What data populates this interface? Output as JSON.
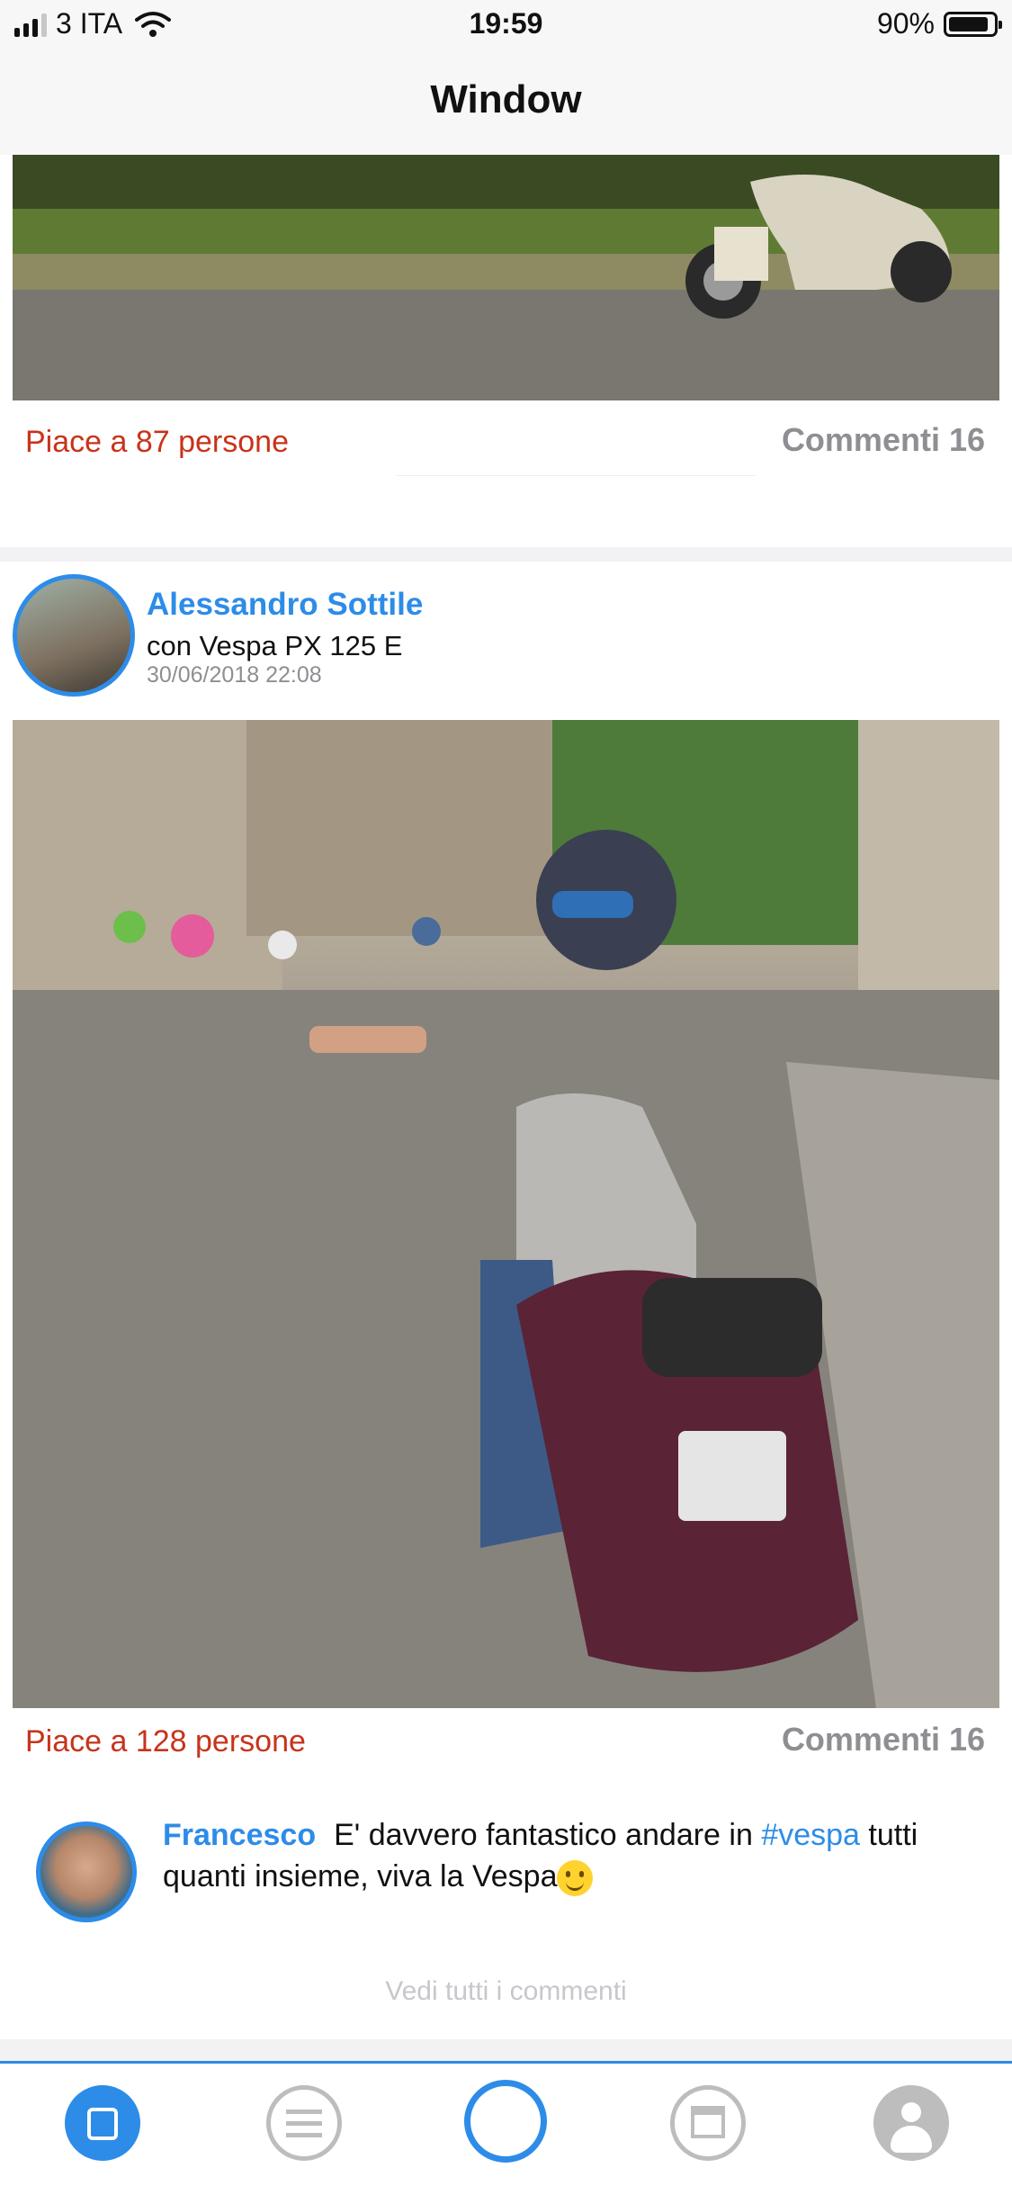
{
  "status_bar": {
    "carrier": "3 ITA",
    "time": "19:59",
    "battery": "90%",
    "battery_level": 0.9,
    "signal_icon": "signal-bars-icon",
    "wifi_icon": "wifi-icon",
    "battery_icon": "battery-icon"
  },
  "nav": {
    "title": "Window"
  },
  "posts": [
    {
      "likes": "Piace a 87 persone",
      "comments": "Commenti 16"
    },
    {
      "author": "Alessandro Sottile",
      "subtitle": "con Vespa PX 125 E",
      "date": "30/06/2018 22:08",
      "likes": "Piace a 128 persone",
      "comments": "Commenti 16",
      "comment": {
        "user": "Francesco",
        "text_before": "E' davvero fantastico andare in ",
        "hashtag": "#vespa",
        "text_after": " tutti quanti insieme, viva la Vespa"
      },
      "see_all": "Vedi tutti i commenti"
    }
  ],
  "tabbar": {
    "icons": [
      "vespa-home-icon",
      "list-icon",
      "create-post-icon",
      "shop-icon",
      "profile-icon"
    ]
  },
  "colors": {
    "accent": "#2d8ce8",
    "likes": "#c8331a",
    "muted": "#8e8e93"
  }
}
